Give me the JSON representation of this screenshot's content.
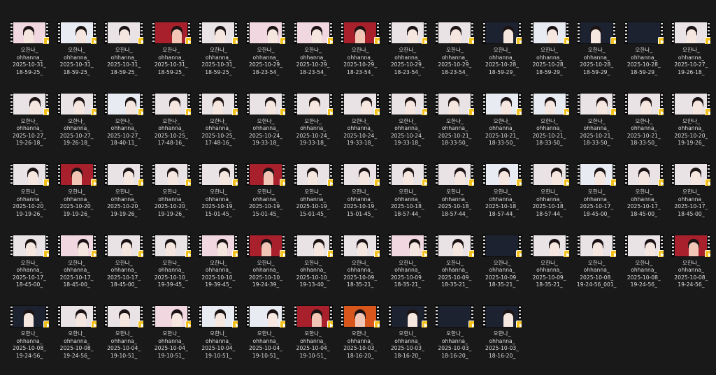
{
  "files": [
    {
      "line1": "오한나_",
      "line2": "ohhanna_",
      "line3": "2025-10-31_",
      "line4": "18-59-25_",
      "scene": "pink"
    },
    {
      "line1": "오한나_",
      "line2": "ohhanna_",
      "line3": "2025-10-31_",
      "line4": "18-59-25_",
      "scene": "pale"
    },
    {
      "line1": "오한나_",
      "line2": "ohhanna_",
      "line3": "2025-10-31_",
      "line4": "18-59-25_",
      "scene": "room"
    },
    {
      "line1": "오한나_",
      "line2": "ohhanna_",
      "line3": "2025-10-31_",
      "line4": "18-59-25_",
      "scene": "red"
    },
    {
      "line1": "오한나_",
      "line2": "ohhanna_",
      "line3": "2025-10-31_",
      "line4": "18-59-25_",
      "scene": "room"
    },
    {
      "line1": "오한나_",
      "line2": "ohhanna_",
      "line3": "2025-10-29_",
      "line4": "18-23-54_",
      "scene": "pink"
    },
    {
      "line1": "오한나_",
      "line2": "ohhanna_",
      "line3": "2025-10-29_",
      "line4": "18-23-54_",
      "scene": "pink"
    },
    {
      "line1": "오한나_",
      "line2": "ohhanna_",
      "line3": "2025-10-29_",
      "line4": "18-23-54_",
      "scene": "red"
    },
    {
      "line1": "오한나_",
      "line2": "ohhanna_",
      "line3": "2025-10-29_",
      "line4": "18-23-54_",
      "scene": "room"
    },
    {
      "line1": "오한나_",
      "line2": "ohhanna_",
      "line3": "2025-10-29_",
      "line4": "18-23-54_",
      "scene": "room"
    },
    {
      "line1": "오한나_",
      "line2": "ohhanna_",
      "line3": "2025-10-28_",
      "line4": "18-59-29_",
      "scene": "dark"
    },
    {
      "line1": "오한나_",
      "line2": "ohhanna_",
      "line3": "2025-10-28_",
      "line4": "18-59-29_",
      "scene": "pale"
    },
    {
      "line1": "오한나_",
      "line2": "ohhanna_",
      "line3": "2025-10-28_",
      "line4": "18-59-29_",
      "scene": "dark"
    },
    {
      "line1": "오한나_",
      "line2": "ohhanna_",
      "line3": "2025-10-28_",
      "line4": "18-59-29_",
      "scene": "dark"
    },
    {
      "line1": "오한나_",
      "line2": "ohhanna_",
      "line3": "2025-10-27_",
      "line4": "19-26-18_",
      "scene": "room"
    },
    {
      "line1": "오한나_",
      "line2": "ohhanna_",
      "line3": "2025-10-27_",
      "line4": "19-26-18_",
      "scene": "room"
    },
    {
      "line1": "오한나_",
      "line2": "ohhanna_",
      "line3": "2025-10-27_",
      "line4": "19-26-18_",
      "scene": "room"
    },
    {
      "line1": "오한나_",
      "line2": "ohhanna_",
      "line3": "2025-10-27_",
      "line4": "18-40-11_",
      "scene": "pale"
    },
    {
      "line1": "오한나_",
      "line2": "ohhanna_",
      "line3": "2025-10-25_",
      "line4": "17-48-16_",
      "scene": "room"
    },
    {
      "line1": "오한나_",
      "line2": "ohhanna_",
      "line3": "2025-10-25_",
      "line4": "17-48-16_",
      "scene": "room"
    },
    {
      "line1": "오한나_",
      "line2": "ohhanna_",
      "line3": "2025-10-24_",
      "line4": "19-33-18_",
      "scene": "room"
    },
    {
      "line1": "오한나_",
      "line2": "ohhanna_",
      "line3": "2025-10-24_",
      "line4": "19-33-18_",
      "scene": "room"
    },
    {
      "line1": "오한나_",
      "line2": "ohhanna_",
      "line3": "2025-10-24_",
      "line4": "19-33-18_",
      "scene": "room"
    },
    {
      "line1": "오한나_",
      "line2": "ohhanna_",
      "line3": "2025-10-24_",
      "line4": "19-33-18_",
      "scene": "room"
    },
    {
      "line1": "오한나_",
      "line2": "ohhanna_",
      "line3": "2025-10-21_",
      "line4": "18-33-50_",
      "scene": "room"
    },
    {
      "line1": "오한나_",
      "line2": "ohhanna_",
      "line3": "2025-10-21_",
      "line4": "18-33-50_",
      "scene": "pale"
    },
    {
      "line1": "오한나_",
      "line2": "ohhanna_",
      "line3": "2025-10-21_",
      "line4": "18-33-50_",
      "scene": "pale"
    },
    {
      "line1": "오한나_",
      "line2": "ohhanna_",
      "line3": "2025-10-21_",
      "line4": "18-33-50_",
      "scene": "room"
    },
    {
      "line1": "오한나_",
      "line2": "ohhanna_",
      "line3": "2025-10-21_",
      "line4": "18-33-50_",
      "scene": "room"
    },
    {
      "line1": "오한나_",
      "line2": "ohhanna_",
      "line3": "2025-10-20_",
      "line4": "19-19-26_",
      "scene": "room"
    },
    {
      "line1": "오한나_",
      "line2": "ohhanna_",
      "line3": "2025-10-20_",
      "line4": "19-19-26_",
      "scene": "room"
    },
    {
      "line1": "오한나_",
      "line2": "ohhanna_",
      "line3": "2025-10-20_",
      "line4": "19-19-26_",
      "scene": "red"
    },
    {
      "line1": "오한나_",
      "line2": "ohhanna_",
      "line3": "2025-10-20_",
      "line4": "19-19-26_",
      "scene": "room"
    },
    {
      "line1": "오한나_",
      "line2": "ohhanna_",
      "line3": "2025-10-20_",
      "line4": "19-19-26_",
      "scene": "room"
    },
    {
      "line1": "오한나_",
      "line2": "ohhanna_",
      "line3": "2025-10-19_",
      "line4": "15-01-45_",
      "scene": "room"
    },
    {
      "line1": "오한나_",
      "line2": "ohhanna_",
      "line3": "2025-10-19_",
      "line4": "15-01-45_",
      "scene": "red"
    },
    {
      "line1": "오한나_",
      "line2": "ohhanna_",
      "line3": "2025-10-19_",
      "line4": "15-01-45_",
      "scene": "room"
    },
    {
      "line1": "오한나_",
      "line2": "ohhanna_",
      "line3": "2025-10-19_",
      "line4": "15-01-45_",
      "scene": "room"
    },
    {
      "line1": "오한나_",
      "line2": "ohhanna_",
      "line3": "2025-10-18_",
      "line4": "18-57-44_",
      "scene": "room"
    },
    {
      "line1": "오한나_",
      "line2": "ohhanna_",
      "line3": "2025-10-18_",
      "line4": "18-57-44_",
      "scene": "room"
    },
    {
      "line1": "오한나_",
      "line2": "ohhanna_",
      "line3": "2025-10-18_",
      "line4": "18-57-44_",
      "scene": "pale"
    },
    {
      "line1": "오한나_",
      "line2": "ohhanna_",
      "line3": "2025-10-18_",
      "line4": "18-57-44_",
      "scene": "room"
    },
    {
      "line1": "오한나_",
      "line2": "ohhanna_",
      "line3": "2025-10-17_",
      "line4": "18-45-00_",
      "scene": "pale"
    },
    {
      "line1": "오한나_",
      "line2": "ohhanna_",
      "line3": "2025-10-17_",
      "line4": "18-45-00_",
      "scene": "room"
    },
    {
      "line1": "오한나_",
      "line2": "ohhanna_",
      "line3": "2025-10-17_",
      "line4": "18-45-00_",
      "scene": "room"
    },
    {
      "line1": "오한나_",
      "line2": "ohhanna_",
      "line3": "2025-10-17_",
      "line4": "18-45-00_",
      "scene": "room"
    },
    {
      "line1": "오한나_",
      "line2": "ohhanna_",
      "line3": "2025-10-17_",
      "line4": "18-45-00_",
      "scene": "pink"
    },
    {
      "line1": "오한나_",
      "line2": "ohhanna_",
      "line3": "2025-10-17_",
      "line4": "18-45-00_",
      "scene": "room"
    },
    {
      "line1": "오한나_",
      "line2": "ohhanna_",
      "line3": "2025-10-10_",
      "line4": "19-39-45_",
      "scene": "room"
    },
    {
      "line1": "오한나_",
      "line2": "ohhanna_",
      "line3": "2025-10-10_",
      "line4": "19-39-45_",
      "scene": "pink"
    },
    {
      "line1": "오한나_",
      "line2": "ohhanna_",
      "line3": "2025-10-10_",
      "line4": "19-24-39_",
      "scene": "red"
    },
    {
      "line1": "오한나_",
      "line2": "ohhanna_",
      "line3": "2025-10-10_",
      "line4": "19-13-40_",
      "scene": "room"
    },
    {
      "line1": "오한나_",
      "line2": "ohhanna_",
      "line3": "2025-10-09_",
      "line4": "18-35-21_",
      "scene": "room"
    },
    {
      "line1": "오한나_",
      "line2": "ohhanna_",
      "line3": "2025-10-09_",
      "line4": "18-35-21_",
      "scene": "pink"
    },
    {
      "line1": "오한나_",
      "line2": "ohhanna_",
      "line3": "2025-10-09_",
      "line4": "18-35-21_",
      "scene": "room"
    },
    {
      "line1": "오한나_",
      "line2": "ohhanna_",
      "line3": "2025-10-09_",
      "line4": "18-35-21_",
      "scene": "dark"
    },
    {
      "line1": "오한나_",
      "line2": "ohhanna_",
      "line3": "2025-10-09_",
      "line4": "18-35-21_",
      "scene": "room"
    },
    {
      "line1": "오한나_",
      "line2": "ohhanna_",
      "line3": "2025-10-08_",
      "line4": "19-24-56_001_",
      "scene": "room"
    },
    {
      "line1": "오한나_",
      "line2": "ohhanna_",
      "line3": "2025-10-08_",
      "line4": "19-24-56_",
      "scene": "room"
    },
    {
      "line1": "오한나_",
      "line2": "ohhanna_",
      "line3": "2025-10-08_",
      "line4": "19-24-56_",
      "scene": "red"
    },
    {
      "line1": "오한나_",
      "line2": "ohhanna_",
      "line3": "2025-10-08_",
      "line4": "19-24-56_",
      "scene": "dark"
    },
    {
      "line1": "오한나_",
      "line2": "ohhanna_",
      "line3": "2025-10-08_",
      "line4": "19-24-56_",
      "scene": "room"
    },
    {
      "line1": "오한나_",
      "line2": "ohhanna_",
      "line3": "2025-10-04_",
      "line4": "19-10-51_",
      "scene": "room"
    },
    {
      "line1": "오한나_",
      "line2": "ohhanna_",
      "line3": "2025-10-04_",
      "line4": "19-10-51_",
      "scene": "pink"
    },
    {
      "line1": "오한나_",
      "line2": "ohhanna_",
      "line3": "2025-10-04_",
      "line4": "19-10-51_",
      "scene": "pale"
    },
    {
      "line1": "오한나_",
      "line2": "ohhanna_",
      "line3": "2025-10-04_",
      "line4": "19-10-51_",
      "scene": "pale"
    },
    {
      "line1": "오한나_",
      "line2": "ohhanna_",
      "line3": "2025-10-04_",
      "line4": "19-10-51_",
      "scene": "red"
    },
    {
      "line1": "오한나_",
      "line2": "ohhanna_",
      "line3": "2025-10-03_",
      "line4": "18-16-20_",
      "scene": "orange"
    },
    {
      "line1": "오한나_",
      "line2": "ohhanna_",
      "line3": "2025-10-03_",
      "line4": "18-16-20_",
      "scene": "dark"
    },
    {
      "line1": "오한나_",
      "line2": "ohhanna_",
      "line3": "2025-10-03_",
      "line4": "18-16-20_",
      "scene": "dark"
    },
    {
      "line1": "오한나_",
      "line2": "ohhanna_",
      "line3": "2025-10-03_",
      "line4": "18-16-20_",
      "scene": "dark"
    }
  ],
  "scene_colors": {
    "room": "#e9e3e6",
    "pale": "#e8ecf2",
    "pink": "#f1d7df",
    "red": "#a8202c",
    "dark": "#1c2230",
    "orange": "#d8561c"
  },
  "badge_color": "#f3c11b"
}
